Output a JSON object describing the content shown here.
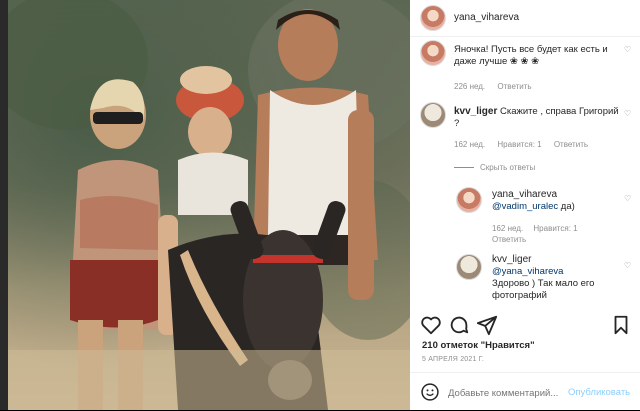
{
  "post": {
    "username": "yana_vihareva",
    "likes": "210 отметок \"Нравится\"",
    "date": "5 АПРЕЛЯ 2021 Г."
  },
  "comments": [
    {
      "text": "Яночка! Пусть все будет как есть и даже лучше",
      "emoji": "❀ ❀ ❀",
      "time": "226 нед.",
      "reply": "Ответить"
    },
    {
      "username": "kvv_liger",
      "text": "Скажите , справа Григорий ?",
      "time": "162 нед.",
      "likes": "Нравится: 1",
      "reply": "Ответить",
      "hide_replies": "Скрыть ответы",
      "replies": [
        {
          "username": "yana_vihareva",
          "mention": "@vadim_uralec",
          "text": "да)",
          "time": "162 нед.",
          "likes": "Нравится: 1",
          "reply": "Ответить"
        },
        {
          "username": "kvv_liger",
          "mention": "@yana_vihareva",
          "text": "Здорово ) Так мало его фотографий"
        }
      ]
    }
  ],
  "footer": {
    "placeholder": "Добавьте комментарий...",
    "publish": "Опубликовать"
  },
  "icons": [
    "heart-icon",
    "comment-icon",
    "share-icon",
    "bookmark-icon",
    "emoji-icon",
    "close-icon",
    "more-icon"
  ],
  "colors": {
    "link": "#00376b",
    "publish": "#0095f6",
    "muted": "#8e8e8e"
  }
}
